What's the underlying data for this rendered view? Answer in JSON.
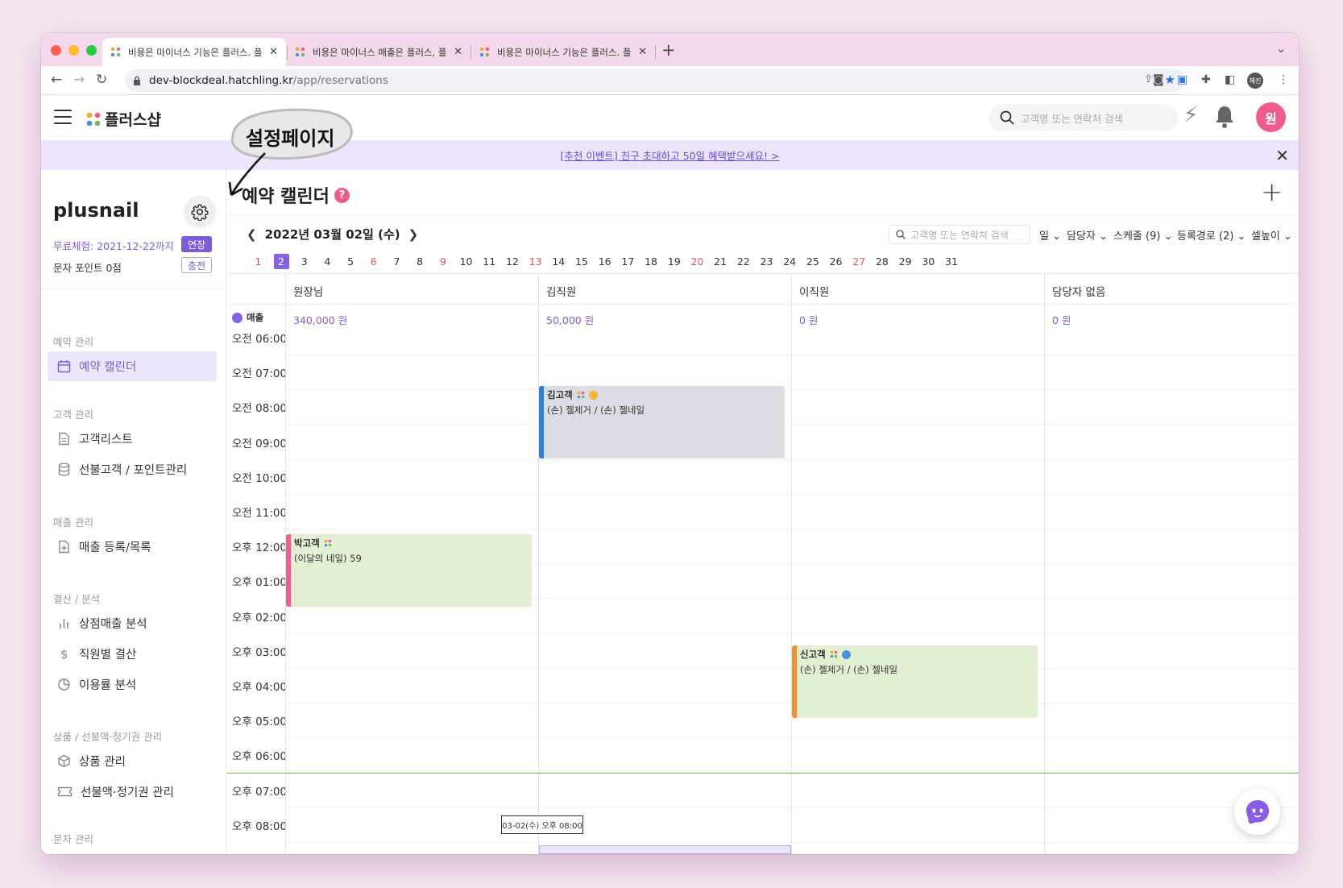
{
  "browser": {
    "tabs": [
      {
        "title": "비용은 마이너스 기능은 플러스. 플러스"
      },
      {
        "title": "비용은 마이너스 매출은 플러스, 플러스"
      },
      {
        "title": "비용은 마이너스 기능은 플러스. 플러스"
      }
    ],
    "url_host": "dev-blockdeal.hatchling.kr",
    "url_path": "/app/reservations",
    "profile_label": "혜진"
  },
  "header": {
    "brand": "플러스샵",
    "search_placeholder": "고객명 또는 연락처 검색",
    "avatar": "원"
  },
  "banner": {
    "text": "[추천 이벤트] 친구 초대하고 50일 혜택받으세요! >"
  },
  "annotation": {
    "text": "설정페이지"
  },
  "sidebar": {
    "shop_name": "plusnail",
    "trial": "무료체험: 2021-12-22까지",
    "extend_label": "연장",
    "points": "문자 포인트 0점",
    "charge_label": "충전",
    "sections": [
      {
        "title": "예약 관리",
        "items": [
          "예약 캘린더"
        ]
      },
      {
        "title": "고객 관리",
        "items": [
          "고객리스트",
          "선불고객 / 포인트관리"
        ]
      },
      {
        "title": "매출 관리",
        "items": [
          "매출 등록/목록"
        ]
      },
      {
        "title": "결산 / 분석",
        "items": [
          "상점매출 분석",
          "직원별 결산",
          "이용률 분석"
        ]
      },
      {
        "title": "상품 / 선불액·정기권 관리",
        "items": [
          "상품 관리",
          "선불액·정기권 관리"
        ]
      },
      {
        "title": "문자 관리",
        "items": []
      }
    ]
  },
  "main": {
    "title": "예약 캘린더",
    "help": "?",
    "date": "2022년 03월 02일 (수)",
    "search_placeholder": "고객명 또는 연락처 검색",
    "filters": [
      "일",
      "담당자",
      "스케줄 (9)",
      "등록경로 (2)",
      "셀높이"
    ],
    "days": [
      "1",
      "2",
      "3",
      "4",
      "5",
      "6",
      "7",
      "8",
      "9",
      "10",
      "11",
      "12",
      "13",
      "14",
      "15",
      "16",
      "17",
      "18",
      "19",
      "20",
      "21",
      "22",
      "23",
      "24",
      "25",
      "26",
      "27",
      "28",
      "29",
      "30",
      "31"
    ],
    "selected_day": "2",
    "red_days": [
      "1",
      "6",
      "9",
      "13",
      "20",
      "27"
    ],
    "sales_label": "매출",
    "staff": [
      {
        "name": "원장님",
        "sales": "340,000 원"
      },
      {
        "name": "김직원",
        "sales": "50,000 원"
      },
      {
        "name": "이직원",
        "sales": "0 원"
      },
      {
        "name": "담당자 없음",
        "sales": "0 원"
      }
    ],
    "times": [
      "오전 06:00",
      "오전 07:00",
      "오전 08:00",
      "오전 09:00",
      "오전 10:00",
      "오전 11:00",
      "오후 12:00",
      "오후 01:00",
      "오후 02:00",
      "오후 03:00",
      "오후 04:00",
      "오후 05:00",
      "오후 06:00",
      "오후 07:00",
      "오후 08:00"
    ],
    "appointments": [
      {
        "customer": "김고객",
        "service": "(손) 젤제거 / (손) 젤네일",
        "bar_color": "#2f7fd6",
        "bg": "#dcdde4",
        "coin": "#f2b632"
      },
      {
        "customer": "박고객",
        "service": "(이달의 네일) 59",
        "bar_color": "#ec5f8f",
        "bg": "#e3efd2",
        "coin": ""
      },
      {
        "customer": "신고객",
        "service": "(손) 젤제거 / (손) 젤네일",
        "bar_color": "#f2942e",
        "bg": "#e3efd2",
        "coin": "#4a90e2"
      }
    ],
    "tooltip": "03-02(수) 오후 08:00"
  },
  "colors": {
    "accent": "#7c5cdc",
    "pink": "#ef5b8c",
    "now_line": "#7bb55a"
  }
}
